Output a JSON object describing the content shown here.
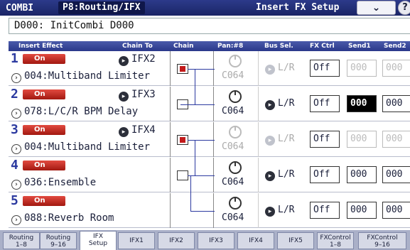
{
  "header": {
    "mode": "COMBI",
    "page": "P8:Routing/IFX",
    "subpage": "Insert FX Setup",
    "menu_icon": "chevron-down-icon",
    "help_icon": "help-icon"
  },
  "combi": "D000: InitCombi D000",
  "columns": {
    "insert_effect": "Insert Effect",
    "chain_to": "Chain To",
    "chain": "Chain",
    "pan": "Pan:#8",
    "bus_sel": "Bus Sel.",
    "fx_ctrl": "FX Ctrl",
    "send1": "Send1",
    "send2": "Send2"
  },
  "rows": [
    {
      "num": "1",
      "on": "On",
      "chain_to": "IFX2",
      "fx": "004:Multiband Limiter",
      "chain_on": true,
      "pan": "C064",
      "bus": "L/R",
      "active": false,
      "fx_ctrl": "Off",
      "send1": "000",
      "send2": "000"
    },
    {
      "num": "2",
      "on": "On",
      "chain_to": "IFX3",
      "fx": "078:L/C/R BPM Delay",
      "chain_on": false,
      "pan": "C064",
      "bus": "L/R",
      "active": true,
      "fx_ctrl": "Off",
      "send1": "000",
      "send2": "000"
    },
    {
      "num": "3",
      "on": "On",
      "chain_to": "IFX4",
      "fx": "004:Multiband Limiter",
      "chain_on": true,
      "pan": "C064",
      "bus": "L/R",
      "active": false,
      "fx_ctrl": "Off",
      "send1": "000",
      "send2": "000"
    },
    {
      "num": "4",
      "on": "On",
      "chain_to": "",
      "fx": "036:Ensemble",
      "chain_on": false,
      "pan": "C064",
      "bus": "L/R",
      "active": true,
      "fx_ctrl": "Off",
      "send1": "000",
      "send2": "000"
    },
    {
      "num": "5",
      "on": "On",
      "chain_to": "",
      "fx": "088:Reverb Room",
      "chain_on": null,
      "pan": "C064",
      "bus": "L/R",
      "active": true,
      "fx_ctrl": "Off",
      "send1": "000",
      "send2": "000"
    }
  ],
  "tabs": [
    {
      "l1": "Routing",
      "l2": "1–8"
    },
    {
      "l1": "Routing",
      "l2": "9–16"
    },
    {
      "l1": "IFX",
      "l2": "Setup"
    },
    {
      "l1": "IFX1",
      "l2": ""
    },
    {
      "l1": "IFX2",
      "l2": ""
    },
    {
      "l1": "IFX3",
      "l2": ""
    },
    {
      "l1": "IFX4",
      "l2": ""
    },
    {
      "l1": "IFX5",
      "l2": ""
    },
    {
      "l1": "FXControl",
      "l2": "1–8"
    },
    {
      "l1": "FXControl",
      "l2": "9–16"
    }
  ],
  "colors": {
    "accent": "#2c3aa0",
    "on_button": "#c21a1a",
    "title_bar": "#1a2566"
  }
}
